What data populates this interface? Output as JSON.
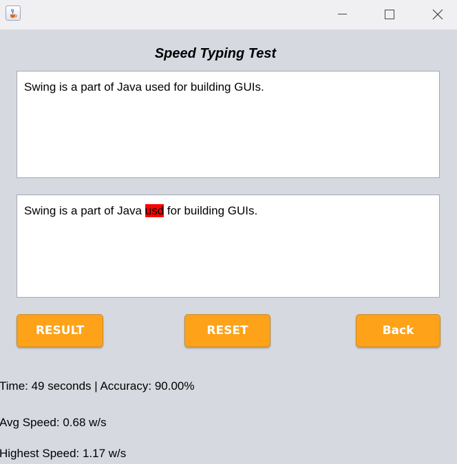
{
  "window": {
    "icon": "java-coffee-cup-icon",
    "controls": [
      "minimize-icon",
      "maximize-icon",
      "close-icon"
    ]
  },
  "heading": "Speed Typing Test",
  "reference_text": "Swing is a part of Java used for building GUIs.",
  "typed_text": {
    "before": "Swing is a part of Java ",
    "error": "usd",
    "after": " for building GUIs.",
    "error_color": "#ff0000"
  },
  "buttons": {
    "result": "RESULT",
    "reset": "RESET",
    "back": "Back",
    "color": "#fda219"
  },
  "stats": {
    "time_accuracy": "Time: 49 seconds | Accuracy: 90.00%",
    "avg_speed": "Avg Speed: 0.68 w/s",
    "highest_speed": "Highest Speed: 1.17 w/s"
  }
}
